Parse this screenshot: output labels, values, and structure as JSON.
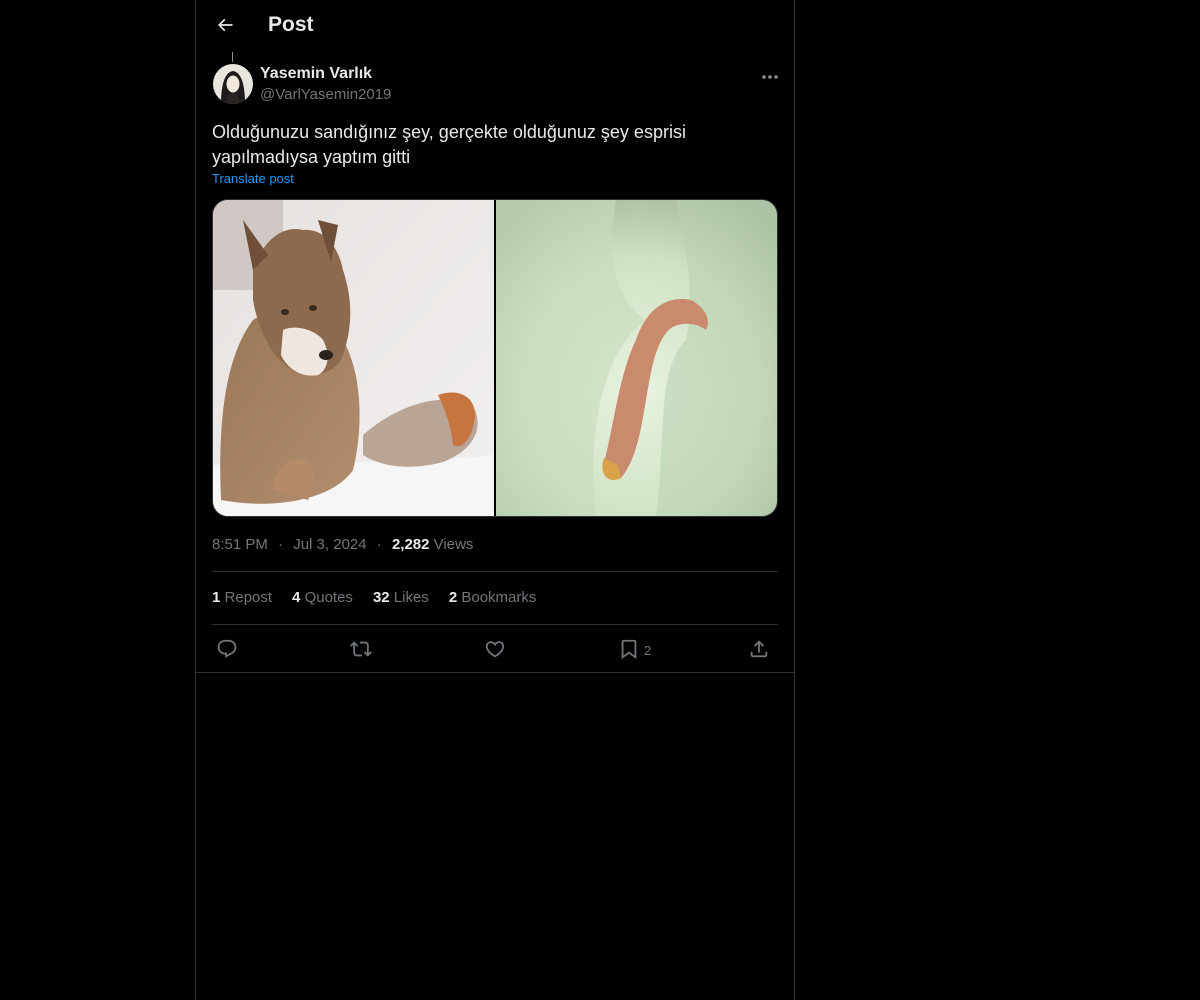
{
  "header": {
    "title": "Post",
    "back_icon": "arrow-left-icon"
  },
  "author": {
    "display_name": "Yasemin Varlık",
    "handle": "@VarlYasemin2019"
  },
  "post": {
    "text": "Olduğunuzu sandığınız şey, gerçekte olduğunuz şey esprisi yapılmadıysa yaptım gitti",
    "translate_label": "Translate post",
    "images": [
      "wolf lying in snow",
      "caterpillar larva on white fluffy surface"
    ]
  },
  "meta": {
    "time": "8:51 PM",
    "date": "Jul 3, 2024",
    "views_count": "2,282",
    "views_label": "Views",
    "separator": "·"
  },
  "stats": {
    "reposts_count": "1",
    "reposts_label": "Repost",
    "quotes_count": "4",
    "quotes_label": "Quotes",
    "likes_count": "32",
    "likes_label": "Likes",
    "bookmarks_count": "2",
    "bookmarks_label": "Bookmarks"
  },
  "actions": {
    "reply_icon": "reply-icon",
    "repost_icon": "repost-icon",
    "like_icon": "heart-icon",
    "bookmark_icon": "bookmark-icon",
    "bookmark_count": "2",
    "share_icon": "share-icon"
  },
  "colors": {
    "background": "#000000",
    "text": "#e7e9ea",
    "muted": "#71767b",
    "border": "#2f3336",
    "link": "#1d9bf0"
  }
}
